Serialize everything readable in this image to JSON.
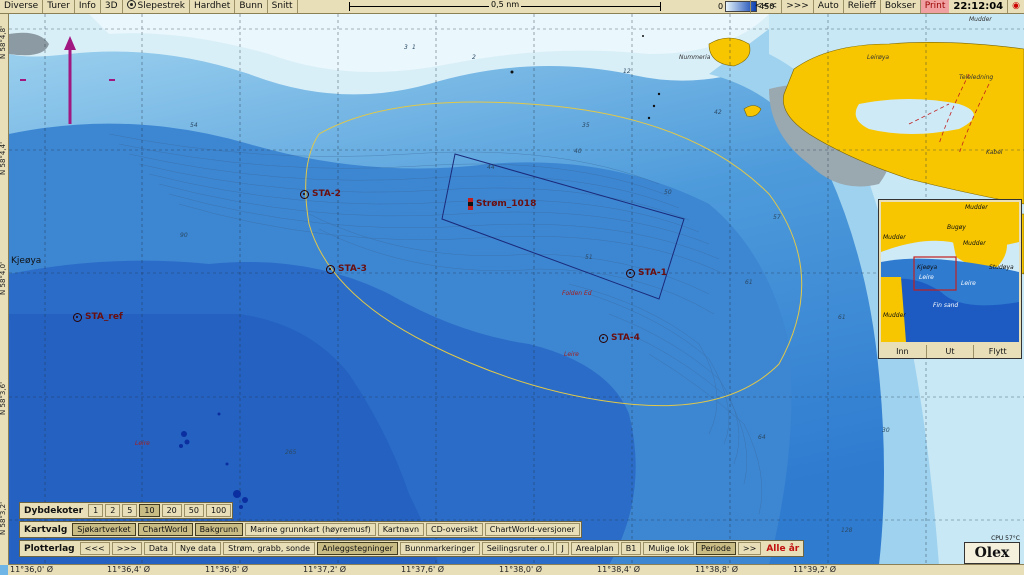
{
  "menu": {
    "left": [
      "Diverse",
      "Turer",
      "Info",
      "3D"
    ],
    "slepestrek": "Slepestrek",
    "middle": [
      "Hardhet",
      "Bunn",
      "Snitt"
    ],
    "scale_label": "0,5 nm",
    "depth_min": "0",
    "depth_max": "450",
    "right": [
      "<<<",
      ">>>",
      "Auto",
      "Relieff",
      "Bokser",
      "Print"
    ],
    "clock": "22:12:04"
  },
  "latitudes": [
    "N 58°4,8'",
    "N 58°4,4'",
    "N 58°4,0'",
    "N 58°3,6'",
    "N 58°3,2'"
  ],
  "longitudes": [
    "11°36,0' Ø",
    "11°36,4' Ø",
    "11°36,8' Ø",
    "11°37,2' Ø",
    "11°37,6' Ø",
    "11°38,0' Ø",
    "11°38,4' Ø",
    "11°38,8' Ø",
    "11°39,2' Ø"
  ],
  "stations": [
    {
      "id": "STA-2",
      "label": "STA-2"
    },
    {
      "id": "STA-3",
      "label": "STA-3"
    },
    {
      "id": "STA-1",
      "label": "STA-1"
    },
    {
      "id": "STA-4",
      "label": "STA-4"
    },
    {
      "id": "STA_ref",
      "label": "STA_ref"
    }
  ],
  "current_marker": "Strøm_1018",
  "places": {
    "kjeoya": "Kjeøya",
    "mudder": "Mudder",
    "leiroya": "Leirøya",
    "teleledning": "Teleledning",
    "kabel": "Kabel",
    "folden": "Folden Ed",
    "leire": "Leire",
    "nummer": "Nummeria"
  },
  "depths": [
    "3",
    "12",
    "2",
    "54",
    "1",
    "35",
    "44",
    "40",
    "42",
    "50",
    "51",
    "61",
    "57",
    "64",
    "61",
    "30",
    "128",
    "265",
    "90"
  ],
  "depth_panel": {
    "title": "Dybdekoter",
    "options": [
      "1",
      "2",
      "5",
      "10",
      "20",
      "50",
      "100"
    ],
    "selected": "10"
  },
  "chart_panel": {
    "title": "Kartvalg",
    "options": [
      "Sjøkartverket",
      "ChartWorld",
      "Bakgrunn",
      "Marine grunnkart (høyremusf)",
      "Kartnavn",
      "CD-oversikt",
      "ChartWorld-versjoner"
    ],
    "active": [
      "Sjøkartverket",
      "ChartWorld",
      "Bakgrunn"
    ]
  },
  "plot_panel": {
    "title": "Plotterlag",
    "options": [
      "<<<",
      ">>>",
      "Data",
      "Nye data",
      "Strøm, grabb, sonde",
      "Anleggstegninger",
      "Bunnmarkeringer",
      "Seilingsruter o.l",
      "J",
      "Arealplan",
      "B1",
      "Mulige lok",
      "Periode",
      ">>"
    ],
    "active": [
      "Anleggstegninger",
      "Periode"
    ],
    "alle_ar": "Alle år"
  },
  "minimap": {
    "labels": {
      "mudder1": "Mudder",
      "mudder2": "Mudder",
      "mudder3": "Mudder",
      "kjeoya": "Kjeøya",
      "leire1": "Leire",
      "leire2": "Leire",
      "fin_sand": "Fin sand",
      "mudder4": "Mudder",
      "bugoya": "Bugøy",
      "studoya": "Studøya"
    },
    "buttons": [
      "Inn",
      "Ut",
      "Flytt"
    ]
  },
  "cpu": "CPU 57°C",
  "brand": "Olex",
  "colors": {
    "land": "#f7c600",
    "shallow": "#e8f6fb",
    "deep": "#1d5bc2",
    "station": "#6a0f0f",
    "track": "#e0c84a",
    "box": "#1a2a7a",
    "arrow": "#a01880"
  }
}
